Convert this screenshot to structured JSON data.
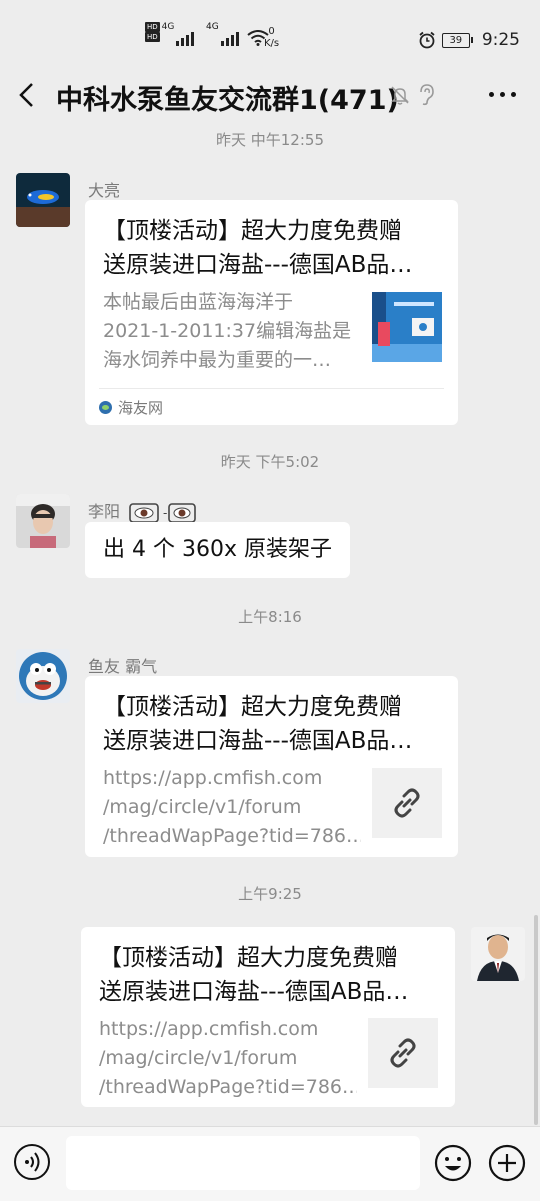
{
  "status_bar": {
    "hd1": "HD",
    "hd2": "HD",
    "net1": "4G",
    "net2": "4G",
    "speed_value": "0",
    "speed_unit": "K/s",
    "battery": "39",
    "time": "9:25"
  },
  "header": {
    "title": "中科水泵鱼友交流群1(471)"
  },
  "messages": [
    {
      "timestamp": "昨天 中午12:55",
      "sender": "大亮",
      "card_title_lines": [
        "【顶楼活动】超大力度免费赠",
        "送原装进口海盐---德国AB品…"
      ],
      "card_desc_lines": [
        "本帖最后由蓝海海洋于",
        "2021-1-2011:37编辑海盐是",
        "海水饲养中最为重要的一…"
      ],
      "source": "海友网"
    },
    {
      "timestamp": "昨天 下午5:02",
      "sender": "李阳",
      "text": "出 4 个 360x 原装架子"
    },
    {
      "timestamp": "上午8:16",
      "sender": "鱼友 霸气",
      "card_title_lines": [
        "【顶楼活动】超大力度免费赠",
        "送原装进口海盐---德国AB品…"
      ],
      "card_desc_lines": [
        "https://app.cmfish.com",
        "/mag/circle/v1/forum",
        "/threadWapPage?tid=786…"
      ]
    },
    {
      "timestamp": "上午9:25",
      "sender": "",
      "card_title_lines": [
        "【顶楼活动】超大力度免费赠",
        "送原装进口海盐---德国AB品…"
      ],
      "card_desc_lines": [
        "https://app.cmfish.com",
        "/mag/circle/v1/forum",
        "/threadWapPage?tid=786…"
      ]
    }
  ],
  "input_bar": {
    "placeholder": ""
  },
  "icons": {
    "back": "chevron-left-icon",
    "mute": "bell-off-icon",
    "earpiece": "ear-icon",
    "more": "more-dots-icon",
    "link": "link-icon",
    "voice": "voice-icon",
    "emoji": "emoji-icon",
    "plus": "plus-icon"
  },
  "colors": {
    "background": "#ededed",
    "bubble": "#ffffff",
    "timestamp": "#8a8a8a",
    "sender": "#7a7a7a",
    "desc": "#8c8c8c"
  }
}
